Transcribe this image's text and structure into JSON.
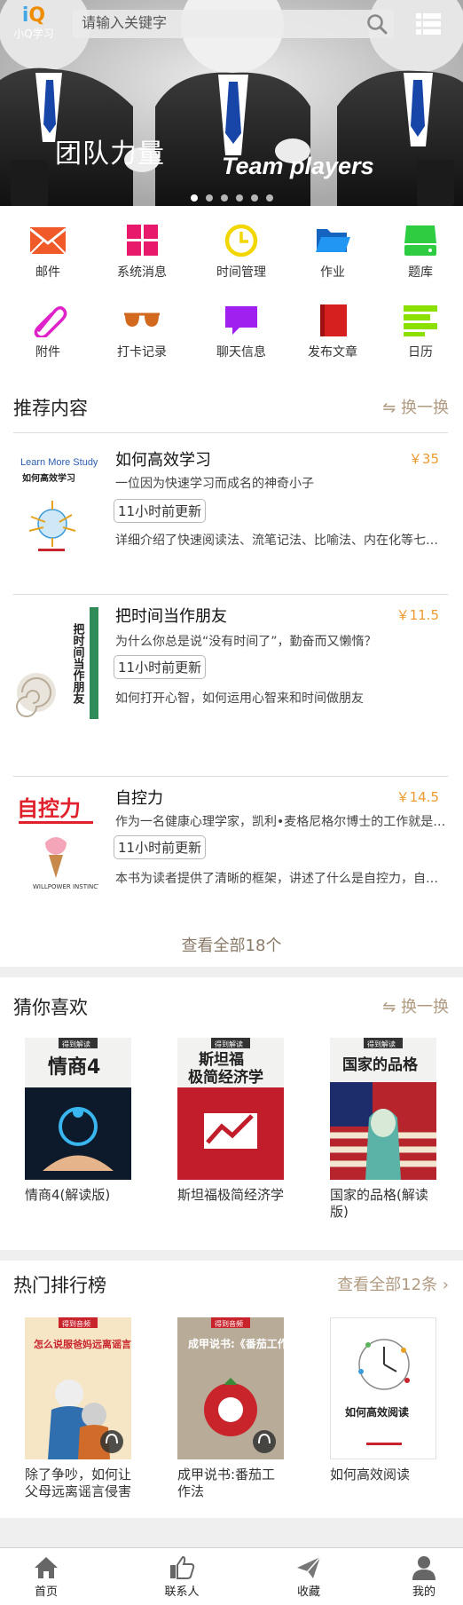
{
  "header": {
    "logo_text": "小Q学习",
    "search_placeholder": "请输入关键字"
  },
  "banner": {
    "title_cn": "团队力量",
    "title_en": "Team players",
    "slides_count": 6,
    "active_slide": 1
  },
  "grid": {
    "items": [
      {
        "label": "邮件",
        "icon": "mail-icon",
        "color": "#f05a28"
      },
      {
        "label": "系统消息",
        "icon": "grid-icon",
        "color": "#e8196b"
      },
      {
        "label": "时间管理",
        "icon": "clock-icon",
        "color": "#f2d600"
      },
      {
        "label": "作业",
        "icon": "folder-icon",
        "color": "#1e88e5"
      },
      {
        "label": "题库",
        "icon": "database-icon",
        "color": "#2ecc40"
      },
      {
        "label": "附件",
        "icon": "paperclip-icon",
        "color": "#e020c8"
      },
      {
        "label": "打卡记录",
        "icon": "sunglasses-icon",
        "color": "#d2691e"
      },
      {
        "label": "聊天信息",
        "icon": "chat-icon",
        "color": "#a020f0"
      },
      {
        "label": "发布文章",
        "icon": "book-icon",
        "color": "#d61f1f"
      },
      {
        "label": "日历",
        "icon": "list-icon",
        "color": "#8be000"
      }
    ]
  },
  "recommend": {
    "title": "推荐内容",
    "action": "换一换",
    "items": [
      {
        "title": "如何高效学习",
        "price": "￥35",
        "subtitle": "一位因为快速学习而成名的神奇小子",
        "time": "11小时前更新",
        "desc": "详细介绍了快速阅读法、流笔记法、比喻法、内在化等七大方法",
        "cover_text": "Learn More Study Less",
        "cover_cn": "如何高效学习"
      },
      {
        "title": "把时间当作朋友",
        "price": "￥11.5",
        "subtitle": "为什么你总是说“没有时间了”，勤奋而又懒惰？",
        "time": "11小时前更新",
        "desc": "如何打开心智，如何运用心智来和时间做朋友",
        "cover_text": "把时间当作朋友",
        "cover_cn": ""
      },
      {
        "title": "自控力",
        "price": "￥14.5",
        "subtitle": "作为一名健康心理学家，凯利•麦格尼格尔博士的工作就是帮助人们管理压力",
        "time": "11小时前更新",
        "desc": "本书为读者提供了清晰的框架，讲述了什么是自控力，自控力如何发挥作用",
        "cover_text": "自控力",
        "cover_cn": "WILLPOWER INSTINCT"
      }
    ],
    "view_all": "查看全部18个"
  },
  "guess": {
    "title": "猜你喜欢",
    "action": "换一换",
    "items": [
      {
        "name": "情商4(解读版)",
        "badge": "得到解读",
        "cover_title": "情商4"
      },
      {
        "name": "斯坦福极简经济学",
        "badge": "得到解读",
        "cover_title": "斯坦福\n极简经济学"
      },
      {
        "name": "国家的品格(解读版)",
        "badge": "得到解读",
        "cover_title": "国家的品格"
      }
    ]
  },
  "ranking": {
    "title": "热门排行榜",
    "action": "查看全部12条",
    "items": [
      {
        "name": "除了争吵，如何让父母远离谣言侵害",
        "badge": "得到音频",
        "cover_title": "怎么说服爸妈远离谣言侵害?"
      },
      {
        "name": "成甲说书:番茄工作法",
        "badge": "得到音频",
        "cover_title": "成甲说书:《番茄工作法》"
      },
      {
        "name": "如何高效阅读",
        "badge": "",
        "cover_title": "如何高效阅读"
      }
    ]
  },
  "tabbar": {
    "items": [
      {
        "label": "首页",
        "icon": "home-icon"
      },
      {
        "label": "联系人",
        "icon": "thumbs-up-icon"
      },
      {
        "label": "收藏",
        "icon": "send-icon"
      },
      {
        "label": "我的",
        "icon": "user-icon"
      }
    ]
  },
  "colors": {
    "price": "#ef9a2e",
    "action": "#b09a80",
    "banner_text": "#ffffff"
  }
}
